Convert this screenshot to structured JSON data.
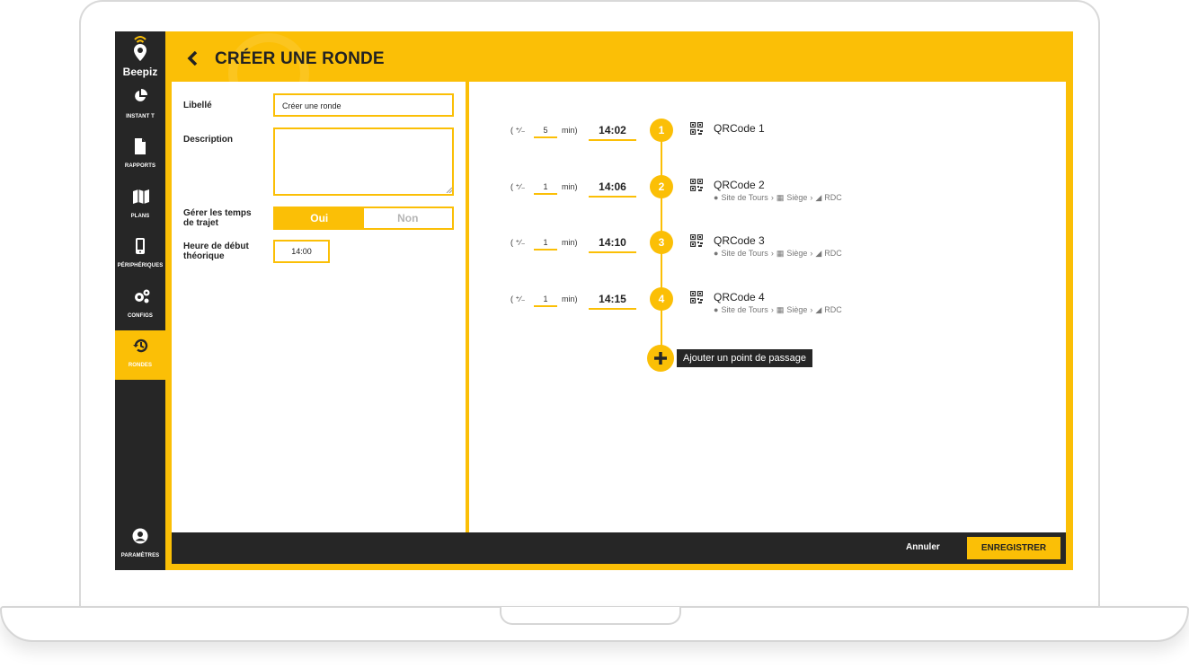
{
  "app": {
    "name": "Beepiz"
  },
  "header": {
    "title": "CRÉER UNE RONDE"
  },
  "sidebar": {
    "items": [
      {
        "label": "INSTANT T",
        "icon": "pie-chart-icon"
      },
      {
        "label": "RAPPORTS",
        "icon": "file-icon"
      },
      {
        "label": "PLANS",
        "icon": "map-icon"
      },
      {
        "label": "PÉRIPHÉRIQUES",
        "icon": "mobile-icon"
      },
      {
        "label": "CONFIGS",
        "icon": "gears-icon"
      },
      {
        "label": "RONDES",
        "icon": "history-icon",
        "active": true
      }
    ],
    "settings_label": "PARAMÈTRES"
  },
  "form": {
    "label_libelle": "Libellé",
    "libelle_value": "Créer une ronde",
    "label_description": "Description",
    "description_value": "",
    "label_trajet_line1": "Gérer les temps",
    "label_trajet_line2": "de trajet",
    "toggle_yes": "Oui",
    "toggle_no": "Non",
    "toggle_selected": "Oui",
    "label_heure_line1": "Heure de début",
    "label_heure_line2": "théorique",
    "heure_value": "14:00"
  },
  "checkpoints": [
    {
      "step": "1",
      "tol_prefix": "( ⁺∕₋",
      "tolerance": "5",
      "unit": "min)",
      "time": "14:02",
      "name": "QRCode 1",
      "site": "",
      "building": "",
      "floor": ""
    },
    {
      "step": "2",
      "tol_prefix": "( ⁺∕₋",
      "tolerance": "1",
      "unit": "min)",
      "time": "14:06",
      "name": "QRCode 2",
      "site": "Site de Tours",
      "building": "Siège",
      "floor": "RDC"
    },
    {
      "step": "3",
      "tol_prefix": "( ⁺∕₋",
      "tolerance": "1",
      "unit": "min)",
      "time": "14:10",
      "name": "QRCode 3",
      "site": "Site de Tours",
      "building": "Siège",
      "floor": "RDC"
    },
    {
      "step": "4",
      "tol_prefix": "( ⁺∕₋",
      "tolerance": "1",
      "unit": "min)",
      "time": "14:15",
      "name": "QRCode 4",
      "site": "Site de Tours",
      "building": "Siège",
      "floor": "RDC"
    }
  ],
  "add_point_label": "Ajouter un point de passage",
  "footer": {
    "cancel_label": "Annuler",
    "save_label": "ENREGISTRER"
  },
  "colors": {
    "accent": "#fbbf06",
    "dark": "#262626"
  }
}
